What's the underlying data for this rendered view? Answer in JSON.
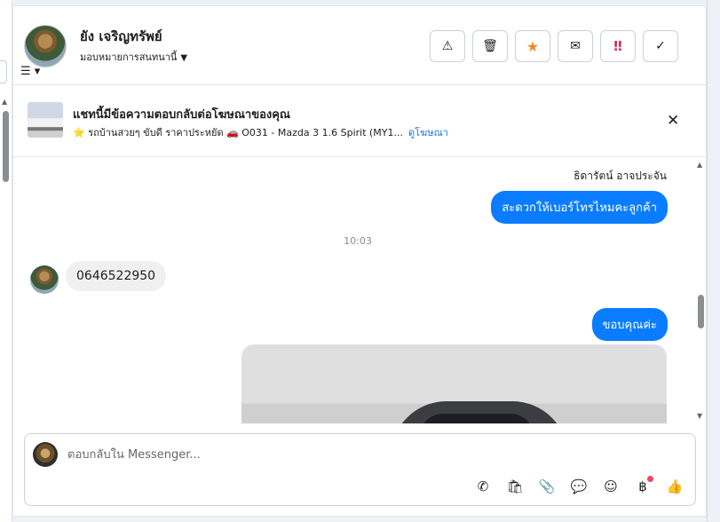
{
  "contact": {
    "name": "ยัง เจริญทรัพย์",
    "assign_label": "มอบหมายการสนทนานี้"
  },
  "header_actions": [
    {
      "icon": "warning-icon",
      "glyph": "⚠"
    },
    {
      "icon": "trash-icon",
      "glyph": "🗑"
    },
    {
      "icon": "star-icon",
      "glyph": "★"
    },
    {
      "icon": "envelope-icon",
      "glyph": "✉"
    },
    {
      "icon": "urgent-icon",
      "glyph": "‼"
    },
    {
      "icon": "check-icon",
      "glyph": "✓"
    }
  ],
  "ad_banner": {
    "title": "แชทนี้มีข้อความตอบกลับต่อโฆษณาของคุณ",
    "listing": "⭐ รถบ้านสวยๆ ขับดี ราคาประหยัด 🚗 O031 - Mazda 3 1.6 Spirit (MY1...",
    "view_ad_link": "ดูโฆษณา"
  },
  "messages": {
    "sender_name": "ธิดารัตน์ อาจประจัน",
    "outgoing_1": "สะดวกให้เบอร์โทรไหมคะลูกค้า",
    "timestamp": "10:03",
    "incoming_1": "0646522950",
    "outgoing_2": "ขอบคุณค่ะ"
  },
  "composer": {
    "placeholder": "ตอบกลับใน Messenger..."
  },
  "composer_tools": [
    {
      "icon": "phone-icon",
      "glyph": "✆"
    },
    {
      "icon": "shopping-bag-icon",
      "glyph": "🛍"
    },
    {
      "icon": "paperclip-icon",
      "glyph": "📎"
    },
    {
      "icon": "chat-bubble-icon",
      "glyph": "💬"
    },
    {
      "icon": "emoji-icon",
      "glyph": "☺"
    },
    {
      "icon": "baht-icon",
      "glyph": "฿"
    },
    {
      "icon": "thumbs-up-icon",
      "glyph": "👍"
    }
  ],
  "colors": {
    "accent": "#0a7cff",
    "link": "#1b74e4",
    "star": "#f28c28",
    "urgent": "#e0245e"
  }
}
